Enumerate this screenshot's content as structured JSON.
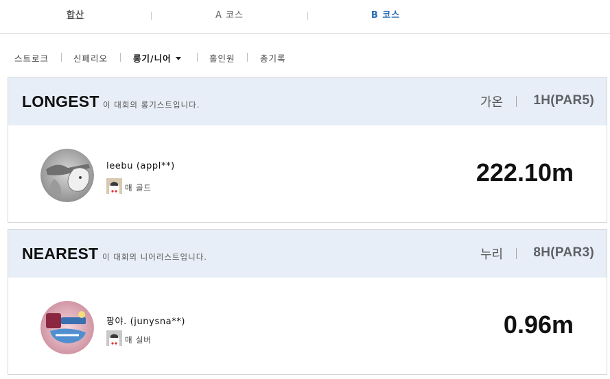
{
  "course_tabs": [
    {
      "label": "합산"
    },
    {
      "label": "A 코스"
    },
    {
      "label": "B 코스"
    }
  ],
  "sub_menu": [
    {
      "label": "스트로크"
    },
    {
      "label": "신페리오"
    },
    {
      "label": "롱기/니어",
      "active": true
    },
    {
      "label": "홀인원"
    },
    {
      "label": "총기록"
    }
  ],
  "records": [
    {
      "title": "LONGEST",
      "description": "이 대회의 롱기스트입니다.",
      "course": "가온",
      "hole": "1H(PAR5)",
      "player": "leebu (appl**)",
      "grade": "매 골드",
      "distance": "222.10m"
    },
    {
      "title": "NEAREST",
      "description": "이 대회의 니어리스트입니다.",
      "course": "누리",
      "hole": "8H(PAR3)",
      "player": "팡야. (junysna**)",
      "grade": "매 실버",
      "distance": "0.96m"
    }
  ],
  "colors": {
    "active_course_tab": "#2a6db5",
    "card_header_bg": "#e8eef7"
  },
  "icons": {
    "dropdown": "caret-down-icon",
    "grade": "grade-character-icon"
  }
}
